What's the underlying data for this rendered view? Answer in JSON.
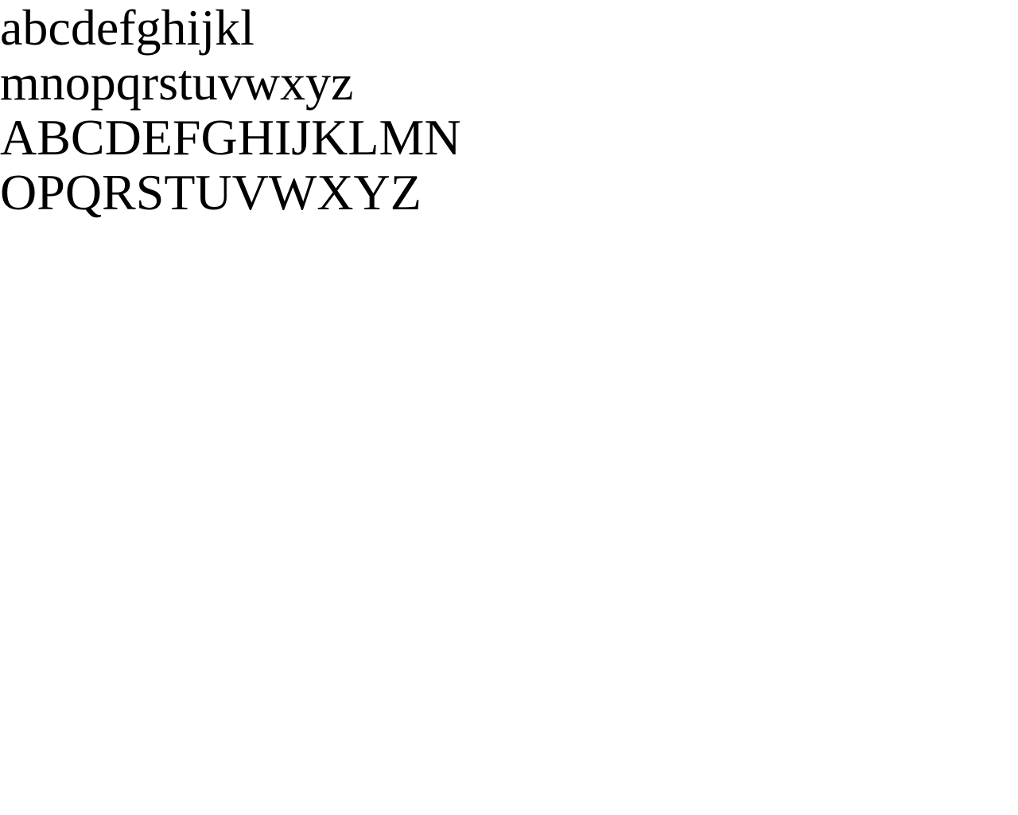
{
  "lines": [
    "abcdefghijkl",
    "mnopqrstuvwxyz",
    "ABCDEFGHIJKLMN",
    "OPQRSTUVWXYZ"
  ],
  "colors": {
    "background": "#ffffff",
    "text": "#000000"
  }
}
